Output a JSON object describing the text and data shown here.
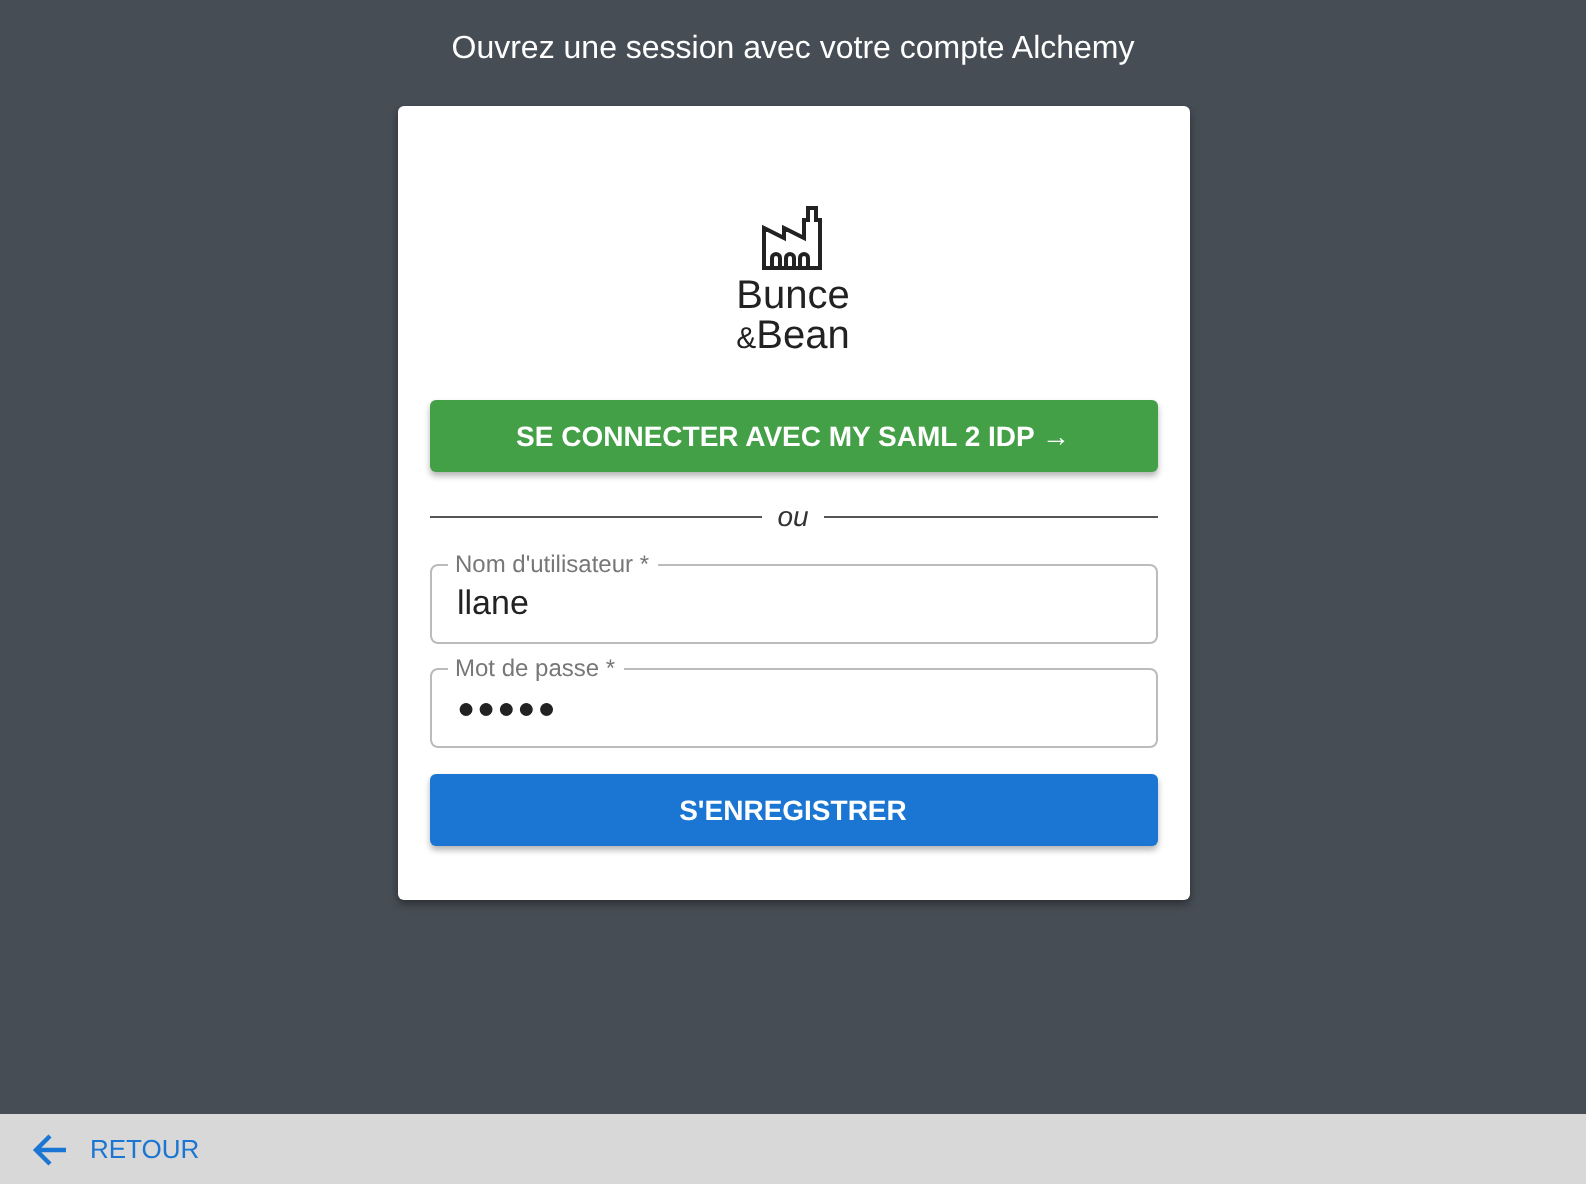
{
  "heading": "Ouvrez une session avec votre compte Alchemy",
  "logo": {
    "line_1": "Bunce",
    "line_2_prefix": "&",
    "line_2": "Bean"
  },
  "sso_button": "SE CONNECTER AVEC MY SAML 2 IDP →",
  "divider": "ou",
  "fields": [
    {
      "label": "Nom d'utilisateur *",
      "value": "llane",
      "kind": "text"
    },
    {
      "label": "Mot de passe *",
      "value": "●●●●●",
      "kind": "password"
    }
  ],
  "submit_button": "S'ENREGISTRER",
  "footer": {
    "back_link": "RETOUR"
  }
}
